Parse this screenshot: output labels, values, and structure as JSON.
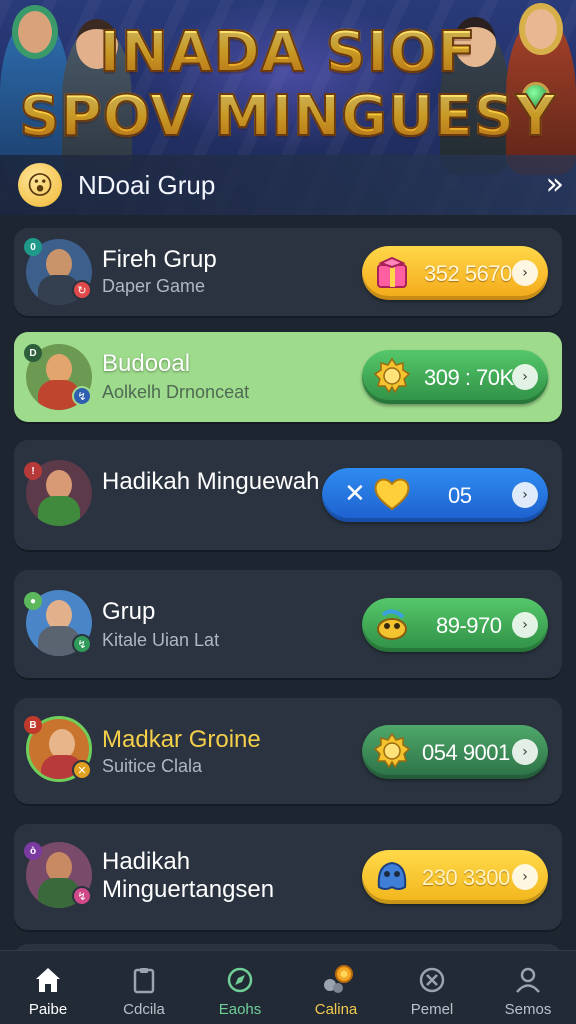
{
  "hero": {
    "title_line1": "INADA SIOF",
    "title_line2": "SPOV MINGUESY",
    "group_name": "NDoai Grup",
    "group_emoji": "😮",
    "arrow": "»"
  },
  "list": [
    {
      "title": "Fireh Grup",
      "subtitle": "Daper Game",
      "value": "352 5670",
      "pill_color": "orange",
      "pill_icon": "gift-box-icon",
      "badge_top": "0",
      "badge_bottom": "↻"
    },
    {
      "title": "Budooal",
      "subtitle": "Aolkelh Drnonceat",
      "value": "309 : 70K",
      "pill_color": "green",
      "pill_icon": "gold-medal-icon",
      "badge_top": "D",
      "badge_bottom": "↯"
    },
    {
      "title": "Hadikah Minguewah",
      "subtitle": "",
      "value": "05",
      "pill_color": "blue",
      "pill_icon": "heart-icon",
      "pill_prefix": "✕",
      "badge_top": "!",
      "badge_bottom": ""
    },
    {
      "title": "Grup",
      "subtitle": "Kitale Uian Lat",
      "value": "89-970",
      "pill_color": "green",
      "pill_icon": "creature-icon",
      "badge_top": "●",
      "badge_bottom": "↯"
    },
    {
      "title": "Madkar Groine",
      "subtitle": "Suitice Clala",
      "value": "054 9001",
      "pill_color": "dgreen",
      "pill_icon": "gold-medal-icon",
      "badge_top": "B",
      "badge_bottom": "✕"
    },
    {
      "title": "Hadikah Minguertangsen",
      "subtitle": "",
      "value": "230 3300",
      "pill_color": "yellow",
      "pill_icon": "blue-monster-icon",
      "badge_top": "ò",
      "badge_bottom": "↯"
    }
  ],
  "pill_go_glyph": "›",
  "nav": [
    {
      "label": "Paibe",
      "icon": "home-icon"
    },
    {
      "label": "Cdcila",
      "icon": "clipboard-icon"
    },
    {
      "label": "Eaohs",
      "icon": "compass-icon"
    },
    {
      "label": "Calina",
      "icon": "coins-icon"
    },
    {
      "label": "Pemel",
      "icon": "cancel-circle-icon"
    },
    {
      "label": "Semos",
      "icon": "profile-icon"
    }
  ]
}
